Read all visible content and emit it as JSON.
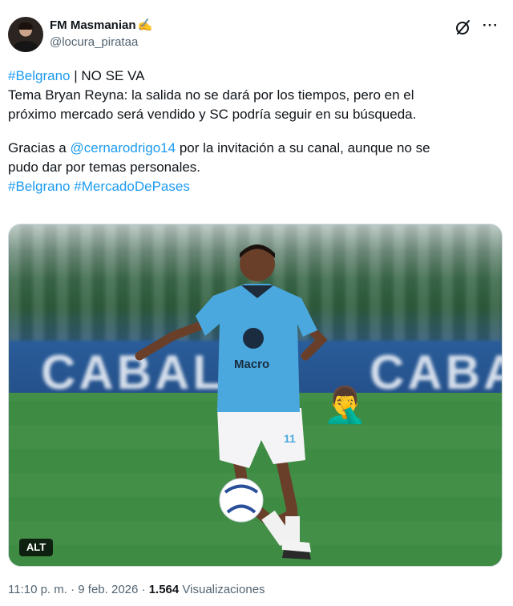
{
  "author": {
    "display_name": "FM Masmanian",
    "name_emoji": "✍️",
    "handle": "@locura_pirataa"
  },
  "header_icons": {
    "grok": "grok-icon",
    "more": "more-options-icon",
    "more_glyph": "···"
  },
  "tweet": {
    "hashtag_belgrano": "#Belgrano",
    "line1_rest": " | NO SE VA",
    "line2": "Tema Bryan Reyna: la salida no se dará por los tiempos, pero en el",
    "line3": "próximo mercado será vendido y SC podría seguir en su búsqueda.",
    "line4_prefix": "Gracias a ",
    "mention": "@cernarodrigo14",
    "line4_suffix": " por la invitación a su canal, aunque no se",
    "line5": "pudo dar por temas personales.",
    "hashtag_end_1": "#Belgrano",
    "hashtag_end_2": "#MercadoDePases"
  },
  "media": {
    "board_text_left": "CABAL",
    "board_text_right": "CABA",
    "shirt_sponsor": "Macro",
    "shirt_number": "11",
    "alt_badge": "ALT",
    "emoji": "🤦‍♂️"
  },
  "meta": {
    "time": "11:10 p. m.",
    "sep1": " · ",
    "date": "9 feb. 2026",
    "sep2": " · ",
    "views_count": "1.564",
    "views_label": " Visualizaciones"
  },
  "colors": {
    "link": "#1d9bf0",
    "secondary_text": "#536471",
    "primary_text": "#0f1419",
    "jersey": "#4aa8df"
  }
}
